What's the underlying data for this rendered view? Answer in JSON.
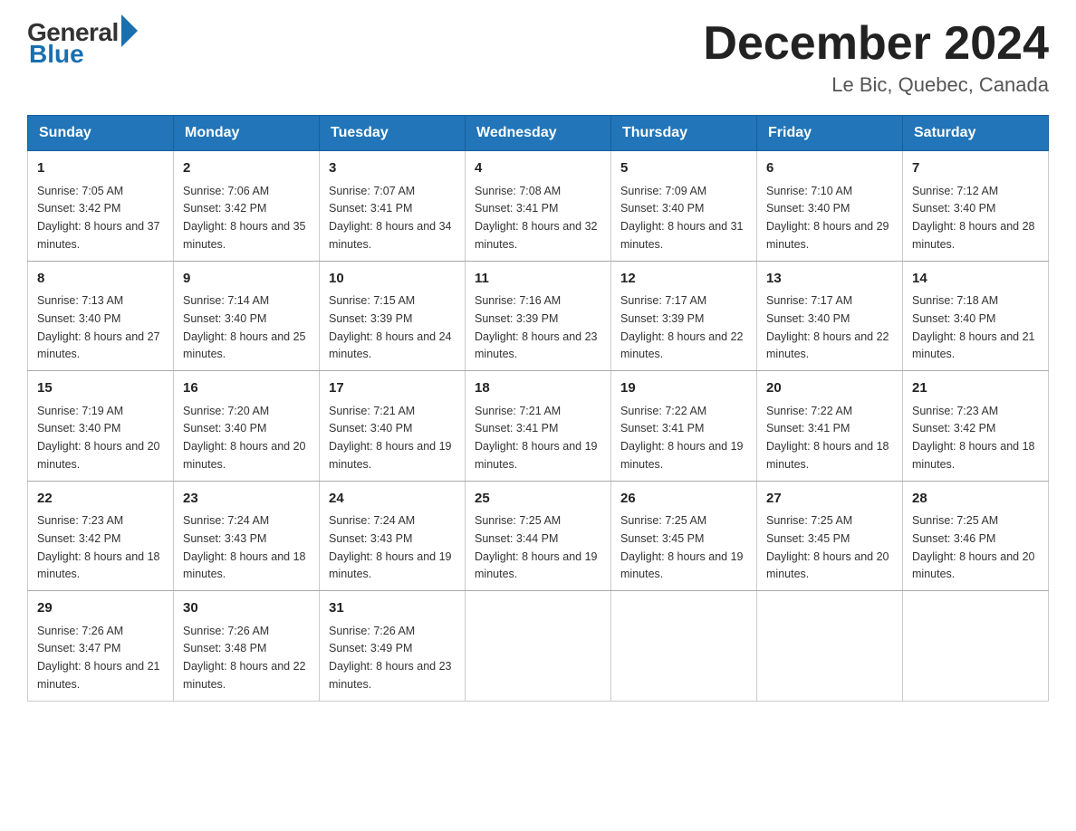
{
  "header": {
    "logo_general": "General",
    "logo_blue": "Blue",
    "month_title": "December 2024",
    "location": "Le Bic, Quebec, Canada"
  },
  "days_of_week": [
    "Sunday",
    "Monday",
    "Tuesday",
    "Wednesday",
    "Thursday",
    "Friday",
    "Saturday"
  ],
  "weeks": [
    [
      {
        "day": "1",
        "sunrise": "7:05 AM",
        "sunset": "3:42 PM",
        "daylight": "8 hours and 37 minutes."
      },
      {
        "day": "2",
        "sunrise": "7:06 AM",
        "sunset": "3:42 PM",
        "daylight": "8 hours and 35 minutes."
      },
      {
        "day": "3",
        "sunrise": "7:07 AM",
        "sunset": "3:41 PM",
        "daylight": "8 hours and 34 minutes."
      },
      {
        "day": "4",
        "sunrise": "7:08 AM",
        "sunset": "3:41 PM",
        "daylight": "8 hours and 32 minutes."
      },
      {
        "day": "5",
        "sunrise": "7:09 AM",
        "sunset": "3:40 PM",
        "daylight": "8 hours and 31 minutes."
      },
      {
        "day": "6",
        "sunrise": "7:10 AM",
        "sunset": "3:40 PM",
        "daylight": "8 hours and 29 minutes."
      },
      {
        "day": "7",
        "sunrise": "7:12 AM",
        "sunset": "3:40 PM",
        "daylight": "8 hours and 28 minutes."
      }
    ],
    [
      {
        "day": "8",
        "sunrise": "7:13 AM",
        "sunset": "3:40 PM",
        "daylight": "8 hours and 27 minutes."
      },
      {
        "day": "9",
        "sunrise": "7:14 AM",
        "sunset": "3:40 PM",
        "daylight": "8 hours and 25 minutes."
      },
      {
        "day": "10",
        "sunrise": "7:15 AM",
        "sunset": "3:39 PM",
        "daylight": "8 hours and 24 minutes."
      },
      {
        "day": "11",
        "sunrise": "7:16 AM",
        "sunset": "3:39 PM",
        "daylight": "8 hours and 23 minutes."
      },
      {
        "day": "12",
        "sunrise": "7:17 AM",
        "sunset": "3:39 PM",
        "daylight": "8 hours and 22 minutes."
      },
      {
        "day": "13",
        "sunrise": "7:17 AM",
        "sunset": "3:40 PM",
        "daylight": "8 hours and 22 minutes."
      },
      {
        "day": "14",
        "sunrise": "7:18 AM",
        "sunset": "3:40 PM",
        "daylight": "8 hours and 21 minutes."
      }
    ],
    [
      {
        "day": "15",
        "sunrise": "7:19 AM",
        "sunset": "3:40 PM",
        "daylight": "8 hours and 20 minutes."
      },
      {
        "day": "16",
        "sunrise": "7:20 AM",
        "sunset": "3:40 PM",
        "daylight": "8 hours and 20 minutes."
      },
      {
        "day": "17",
        "sunrise": "7:21 AM",
        "sunset": "3:40 PM",
        "daylight": "8 hours and 19 minutes."
      },
      {
        "day": "18",
        "sunrise": "7:21 AM",
        "sunset": "3:41 PM",
        "daylight": "8 hours and 19 minutes."
      },
      {
        "day": "19",
        "sunrise": "7:22 AM",
        "sunset": "3:41 PM",
        "daylight": "8 hours and 19 minutes."
      },
      {
        "day": "20",
        "sunrise": "7:22 AM",
        "sunset": "3:41 PM",
        "daylight": "8 hours and 18 minutes."
      },
      {
        "day": "21",
        "sunrise": "7:23 AM",
        "sunset": "3:42 PM",
        "daylight": "8 hours and 18 minutes."
      }
    ],
    [
      {
        "day": "22",
        "sunrise": "7:23 AM",
        "sunset": "3:42 PM",
        "daylight": "8 hours and 18 minutes."
      },
      {
        "day": "23",
        "sunrise": "7:24 AM",
        "sunset": "3:43 PM",
        "daylight": "8 hours and 18 minutes."
      },
      {
        "day": "24",
        "sunrise": "7:24 AM",
        "sunset": "3:43 PM",
        "daylight": "8 hours and 19 minutes."
      },
      {
        "day": "25",
        "sunrise": "7:25 AM",
        "sunset": "3:44 PM",
        "daylight": "8 hours and 19 minutes."
      },
      {
        "day": "26",
        "sunrise": "7:25 AM",
        "sunset": "3:45 PM",
        "daylight": "8 hours and 19 minutes."
      },
      {
        "day": "27",
        "sunrise": "7:25 AM",
        "sunset": "3:45 PM",
        "daylight": "8 hours and 20 minutes."
      },
      {
        "day": "28",
        "sunrise": "7:25 AM",
        "sunset": "3:46 PM",
        "daylight": "8 hours and 20 minutes."
      }
    ],
    [
      {
        "day": "29",
        "sunrise": "7:26 AM",
        "sunset": "3:47 PM",
        "daylight": "8 hours and 21 minutes."
      },
      {
        "day": "30",
        "sunrise": "7:26 AM",
        "sunset": "3:48 PM",
        "daylight": "8 hours and 22 minutes."
      },
      {
        "day": "31",
        "sunrise": "7:26 AM",
        "sunset": "3:49 PM",
        "daylight": "8 hours and 23 minutes."
      },
      null,
      null,
      null,
      null
    ]
  ],
  "labels": {
    "sunrise_prefix": "Sunrise: ",
    "sunset_prefix": "Sunset: ",
    "daylight_prefix": "Daylight: "
  }
}
